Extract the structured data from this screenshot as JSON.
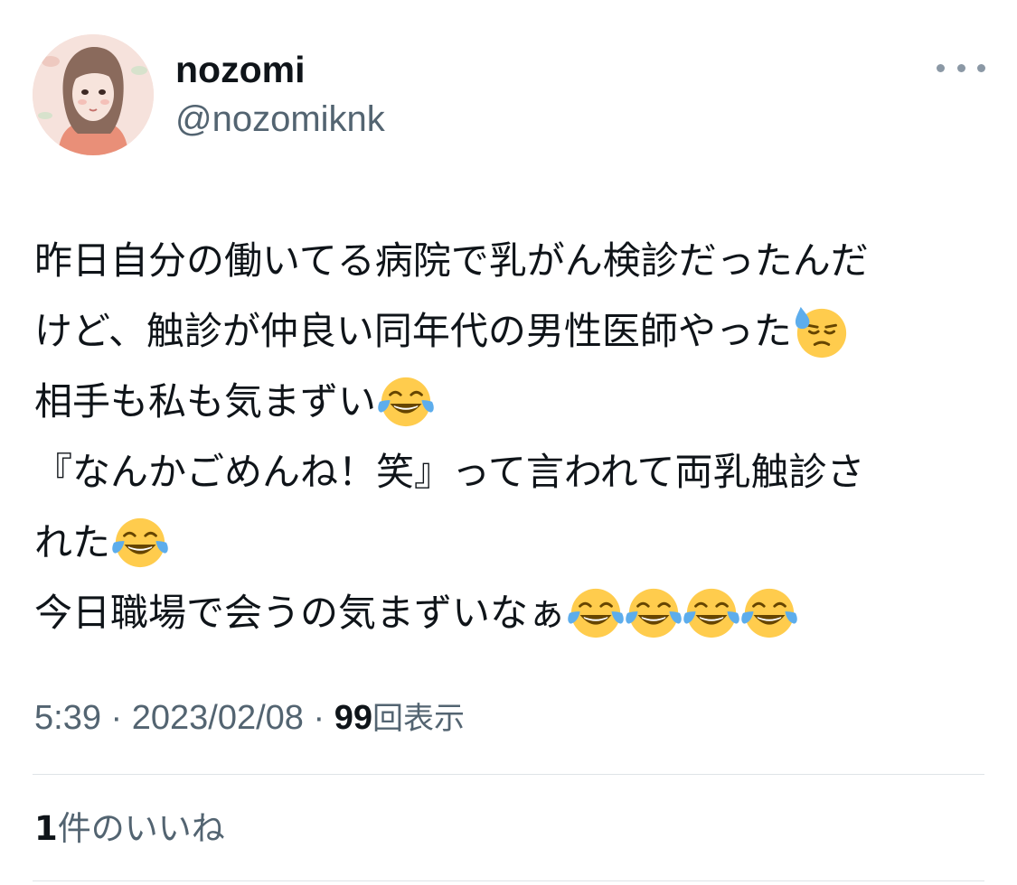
{
  "user": {
    "display_name": "nozomi",
    "handle": "@nozomiknk"
  },
  "tweet": {
    "lines": [
      {
        "text": "昨日自分の働いてる病院で乳がん検診だったんだ",
        "emojis": []
      },
      {
        "text": "けど、触診が仲良い同年代の男性医師やった",
        "emojis": [
          "downcast-face-with-sweat"
        ]
      },
      {
        "text": "相手も私も気まずい",
        "emojis": [
          "face-with-tears-of-joy"
        ]
      },
      {
        "text": "『なんかごめんね！笑』って言われて両乳触診さ",
        "emojis": []
      },
      {
        "text": "れた",
        "emojis": [
          "face-with-tears-of-joy"
        ]
      },
      {
        "text": "今日職場で会うの気まずいなぁ",
        "emojis": [
          "face-with-tears-of-joy",
          "face-with-tears-of-joy",
          "face-with-tears-of-joy",
          "face-with-tears-of-joy"
        ]
      }
    ]
  },
  "meta": {
    "time": "5:39",
    "separator": " · ",
    "date": "2023/02/08",
    "views_count": "99",
    "views_label": "回表示"
  },
  "engagement": {
    "likes_count": "1",
    "likes_label": "件のいいね"
  },
  "colors": {
    "text_primary": "#0f1419",
    "text_secondary": "#536471",
    "divider": "#dfe3e7"
  }
}
